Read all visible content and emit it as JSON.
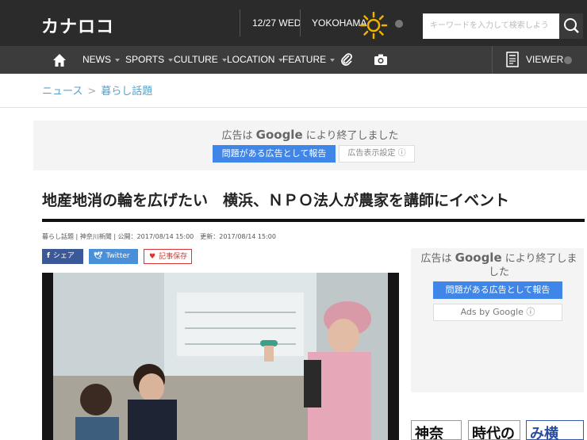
{
  "header": {
    "logo": "カナロコ",
    "date": "12/27 WED",
    "city": "YOKOHAMA",
    "weather_icon": "sun-icon",
    "search_placeholder": "キーワードを入力して検索しよう"
  },
  "nav": {
    "items": [
      "NEWS",
      "SPORTS",
      "CULTURE",
      "LOCATION",
      "FEATURE"
    ],
    "viewer_label": "VIEWER"
  },
  "breadcrumb": {
    "items": [
      "ニュース",
      "暮らし話題"
    ],
    "separator": ">"
  },
  "ad_top": {
    "prefix": "広告は",
    "brand": "Google",
    "suffix": "により終了しました",
    "report_button": "問題がある広告として報告",
    "settings_button": "広告表示設定 ⓘ"
  },
  "article": {
    "title": "地産地消の輪を広げたい　横浜、ＮＰＯ法人が農家を講師にイベント",
    "meta": "暮らし話題 | 神奈川新聞 | 公開：2017/08/14 15:00　更新：2017/08/14 15:00",
    "share_fb": "シェア",
    "share_tw": "Twitter",
    "save": "記事保存"
  },
  "ad_side": {
    "prefix": "広告は",
    "brand": "Google",
    "suffix": "により終了しました",
    "report_button": "問題がある広告として報告",
    "ads_by": "Ads by Google ⓘ"
  },
  "thumbs": [
    "神奈",
    "時代の",
    "み横"
  ],
  "colors": {
    "header_bg": "#2b2b2b",
    "nav_bg": "#3c3c3c",
    "link": "#5aa0c8",
    "ad_blue": "#3f86e8",
    "facebook": "#3b5998",
    "twitter": "#4a90d9",
    "save_red": "#dd3333"
  }
}
